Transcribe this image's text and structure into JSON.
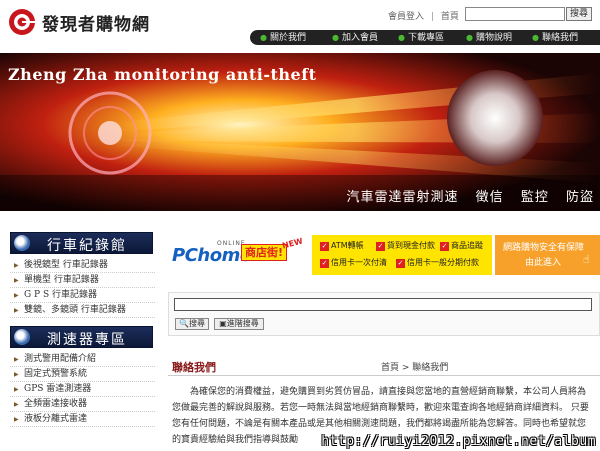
{
  "site": {
    "name": "發現者購物網"
  },
  "toplinks": {
    "login": "會員登入",
    "separator": "|",
    "home": "首頁",
    "search_button": "搜尋"
  },
  "nav": {
    "items": [
      "關於我們",
      "加入會員",
      "下載專區",
      "購物說明",
      "聯絡我們"
    ]
  },
  "banner": {
    "title": "Zheng Zha monitoring anti-theft",
    "keywords": [
      "汽車雷達雷射測速",
      "徵信",
      "監控",
      "防盜"
    ]
  },
  "sidebar": {
    "sections": [
      {
        "heading": "行車紀錄館",
        "items": [
          "後視鏡型 行車記錄器",
          "單機型 行車記錄器",
          "G P S 行車記錄器",
          "雙鏡、多鏡頭 行車記錄器"
        ]
      },
      {
        "heading": "測速器專區",
        "items": [
          "測式警用配備介紹",
          "固定式預警系統",
          "GPS 雷達測速器",
          "全頻雷達接收器",
          "液板分離式雷達"
        ]
      }
    ]
  },
  "promo": {
    "brand": "PChome",
    "online": "ONLINE",
    "shop": "商店街!",
    "new_tag": "NEW",
    "features": [
      "ATM轉帳",
      "貨到現金付款",
      "商品追蹤",
      "信用卡一次付清",
      "信用卡一般分期付款"
    ],
    "safety_line1": "網路購物安全有保障",
    "safety_line2": "由此進入"
  },
  "search_panel": {
    "search_button": "搜尋",
    "advanced_button": "進階搜尋"
  },
  "content": {
    "title": "聯絡我們",
    "breadcrumb_home": "首頁",
    "breadcrumb_sep": " > ",
    "breadcrumb_current": "聯絡我們",
    "paragraph": "為確保您的消費權益，避免購買到劣質仿冒品，請直接與您當地的直營經銷商聯繫，本公司人員將為您做最完善的解說與服務。若您一時無法與當地經銷商聯繫時，歡迎來電查詢各地經銷商詳細資料。 只要您有任何問題，不論是有關本產品或是其他相關測速問題，我們都將竭盡所能為您解答。同時也希望就您的寶貴經驗給與我們指導與鼓勵"
  },
  "watermark": {
    "text": "http://ruiyi2012.pixnet.net/album"
  },
  "colors": {
    "accent_red": "#c8161d",
    "nav_bg": "#222222",
    "sidebar_head": "#0c1838",
    "promo_yellow": "#ffe400",
    "promo_orange": "#f7a12a"
  }
}
